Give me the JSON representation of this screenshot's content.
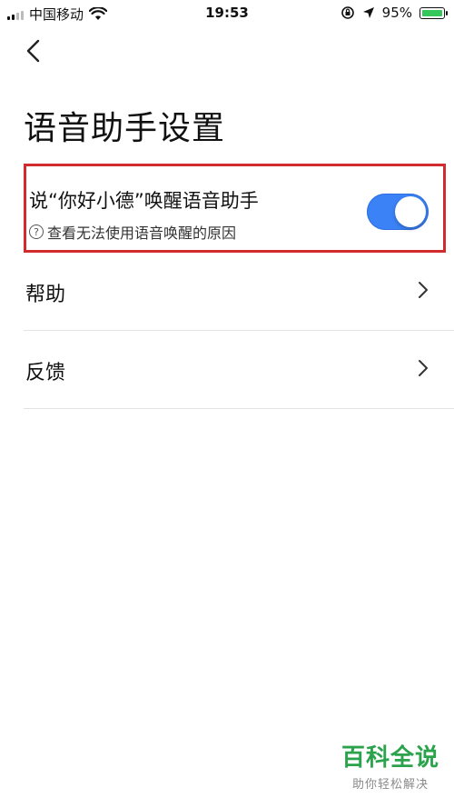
{
  "status_bar": {
    "carrier": "中国移动",
    "time": "19:53",
    "battery_percent": "95%",
    "battery_level": 0.95,
    "signal_strength": 2,
    "icons": [
      "signal-icon",
      "wifi-icon",
      "orientation-lock-icon",
      "location-arrow-icon",
      "battery-icon"
    ]
  },
  "header": {
    "back_icon": "chevron-left-icon",
    "title": "语音助手设置"
  },
  "wake_setting": {
    "label": "说“你好小德”唤醒语音助手",
    "help_text": "查看无法使用语音唤醒的原因",
    "help_icon": "question-circle-icon",
    "enabled": true,
    "switch_color": "#3b82f6"
  },
  "menu": {
    "items": [
      {
        "label": "帮助",
        "icon": "chevron-right-icon"
      },
      {
        "label": "反馈",
        "icon": "chevron-right-icon"
      }
    ]
  },
  "watermark": {
    "title": "百科全说",
    "subtitle": "助你轻松解决"
  },
  "colors": {
    "highlight_border": "#d12b2e",
    "watermark_green": "#2ba24c"
  }
}
